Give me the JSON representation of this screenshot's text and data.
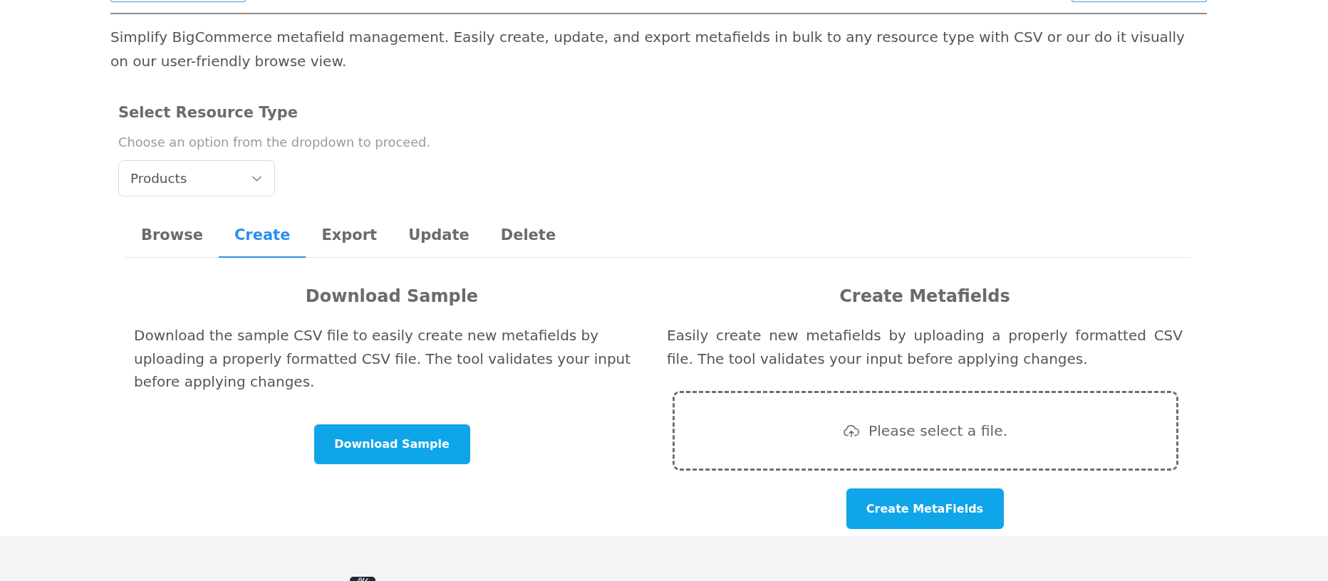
{
  "description": "Simplify BigCommerce metafield management. Easily create, update, and export metafields in bulk to any resource type with CSV or our do it visually on our user-friendly browse view.",
  "resource_select": {
    "label": "Select Resource Type",
    "hint": "Choose an option from the dropdown to proceed.",
    "value": "Products"
  },
  "tabs": [
    {
      "label": "Browse",
      "selected": false
    },
    {
      "label": "Create",
      "selected": true
    },
    {
      "label": "Export",
      "selected": false
    },
    {
      "label": "Update",
      "selected": false
    },
    {
      "label": "Delete",
      "selected": false
    }
  ],
  "panels": [
    {
      "kind": "download",
      "title": "Download Sample",
      "text": "Download the sample CSV file to easily create new metafields by uploading a properly formatted CSV file. The tool validates your input before applying changes.",
      "button": "Download Sample"
    },
    {
      "kind": "upload",
      "title": "Create Metafields",
      "text": "Easily create new metafields by uploading a properly formatted CSV file. The tool validates your input before applying changes.",
      "dropzone": {
        "prompt": "Please select a file."
      },
      "button": "Create MetaFields"
    }
  ]
}
